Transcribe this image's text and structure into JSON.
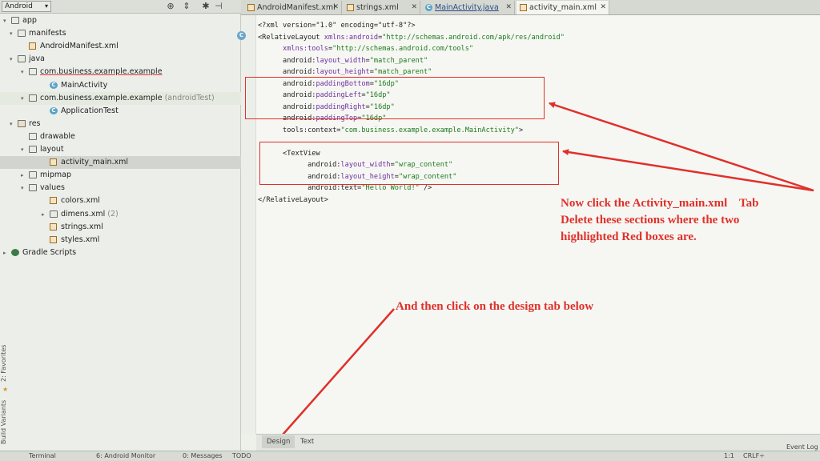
{
  "project_panel": {
    "view_selector": "Android",
    "tree": [
      {
        "label": "app",
        "suffix": "",
        "indent": 0,
        "arrow": "▾",
        "icon": "app-folder-icon"
      },
      {
        "label": "manifests",
        "suffix": "",
        "indent": 1,
        "arrow": "▾",
        "icon": "folder-icon"
      },
      {
        "label": "AndroidManifest.xml",
        "suffix": "",
        "indent": 2,
        "arrow": "",
        "icon": "xml-file-icon"
      },
      {
        "label": "java",
        "suffix": "",
        "indent": 1,
        "arrow": "▾",
        "icon": "folder-icon"
      },
      {
        "label": "com.business.example.example",
        "suffix": "",
        "indent": 2,
        "arrow": "▾",
        "icon": "package-icon"
      },
      {
        "label": "MainActivity",
        "suffix": "",
        "indent": 3,
        "arrow": "",
        "icon": "class-icon"
      },
      {
        "label": "com.business.example.example",
        "suffix": " (androidTest)",
        "indent": 2,
        "arrow": "▾",
        "icon": "package-icon"
      },
      {
        "label": "ApplicationTest",
        "suffix": "",
        "indent": 3,
        "arrow": "",
        "icon": "class-icon"
      },
      {
        "label": "res",
        "suffix": "",
        "indent": 1,
        "arrow": "▾",
        "icon": "res-folder-icon"
      },
      {
        "label": "drawable",
        "suffix": "",
        "indent": 2,
        "arrow": "",
        "icon": "folder-icon"
      },
      {
        "label": "layout",
        "suffix": "",
        "indent": 2,
        "arrow": "▾",
        "icon": "folder-icon"
      },
      {
        "label": "activity_main.xml",
        "suffix": "",
        "indent": 3,
        "arrow": "",
        "icon": "xml-file-icon"
      },
      {
        "label": "mipmap",
        "suffix": "",
        "indent": 2,
        "arrow": "▸",
        "icon": "folder-icon"
      },
      {
        "label": "values",
        "suffix": "",
        "indent": 2,
        "arrow": "▾",
        "icon": "folder-icon"
      },
      {
        "label": "colors.xml",
        "suffix": "",
        "indent": 3,
        "arrow": "",
        "icon": "xml-file-icon"
      },
      {
        "label": "dimens.xml",
        "suffix": " (2)",
        "indent": 3,
        "arrow": "▸",
        "icon": "folder-icon"
      },
      {
        "label": "strings.xml",
        "suffix": "",
        "indent": 3,
        "arrow": "",
        "icon": "xml-file-icon"
      },
      {
        "label": "styles.xml",
        "suffix": "",
        "indent": 3,
        "arrow": "",
        "icon": "xml-file-icon"
      },
      {
        "label": "Gradle Scripts",
        "suffix": "",
        "indent": 0,
        "arrow": "▸",
        "icon": "gradle-icon"
      }
    ],
    "selected_item": "activity_main.xml",
    "side_tabs": [
      "2: Favorites",
      "Build Variants"
    ]
  },
  "editor_tabs": [
    {
      "label": "AndroidManifest.xml",
      "icon": "xml-file-icon",
      "active": false
    },
    {
      "label": "strings.xml",
      "icon": "xml-file-icon",
      "active": false
    },
    {
      "label": "MainActivity.java",
      "icon": "class-icon",
      "active": false
    },
    {
      "label": "activity_main.xml",
      "icon": "xml-file-icon",
      "active": true
    }
  ],
  "code_lines": [
    {
      "indent": 0,
      "parts": [
        [
          "t",
          "<?xml version=\"1.0\" encoding=\"utf-8\"?>"
        ]
      ]
    },
    {
      "indent": 0,
      "parts": [
        [
          "t",
          "<RelativeLayout "
        ],
        [
          "a",
          "xmlns:android"
        ],
        [
          "t",
          "="
        ],
        [
          "v",
          "\"http://schemas.android.com/apk/res/android\""
        ]
      ]
    },
    {
      "indent": 1,
      "parts": [
        [
          "a",
          "xmlns:tools"
        ],
        [
          "t",
          "="
        ],
        [
          "v",
          "\"http://schemas.android.com/tools\""
        ]
      ]
    },
    {
      "indent": 1,
      "parts": [
        [
          "t",
          "android:"
        ],
        [
          "a",
          "layout_width"
        ],
        [
          "t",
          "="
        ],
        [
          "v",
          "\"match_parent\""
        ]
      ]
    },
    {
      "indent": 1,
      "parts": [
        [
          "t",
          "android:"
        ],
        [
          "a",
          "layout_height"
        ],
        [
          "t",
          "="
        ],
        [
          "v",
          "\"match_parent\""
        ]
      ]
    },
    {
      "indent": 1,
      "parts": [
        [
          "t",
          "android:"
        ],
        [
          "a",
          "paddingBottom"
        ],
        [
          "t",
          "="
        ],
        [
          "v",
          "\"16dp\""
        ]
      ]
    },
    {
      "indent": 1,
      "parts": [
        [
          "t",
          "android:"
        ],
        [
          "a",
          "paddingLeft"
        ],
        [
          "t",
          "="
        ],
        [
          "v",
          "\"16dp\""
        ]
      ]
    },
    {
      "indent": 1,
      "parts": [
        [
          "t",
          "android:"
        ],
        [
          "a",
          "paddingRight"
        ],
        [
          "t",
          "="
        ],
        [
          "v",
          "\"16dp\""
        ]
      ]
    },
    {
      "indent": 1,
      "parts": [
        [
          "t",
          "android:"
        ],
        [
          "a",
          "paddingTop"
        ],
        [
          "t",
          "="
        ],
        [
          "v",
          "\"16dp\""
        ]
      ]
    },
    {
      "indent": 1,
      "parts": [
        [
          "t",
          "tools:context="
        ],
        [
          "v",
          "\"com.business.example.example.MainActivity\""
        ],
        [
          "t",
          ">"
        ]
      ]
    },
    {
      "indent": 0,
      "parts": [
        [
          "t",
          ""
        ]
      ]
    },
    {
      "indent": 1,
      "parts": [
        [
          "t",
          "<TextView"
        ]
      ]
    },
    {
      "indent": 2,
      "parts": [
        [
          "t",
          "android:"
        ],
        [
          "a",
          "layout_width"
        ],
        [
          "t",
          "="
        ],
        [
          "v",
          "\"wrap_content\""
        ]
      ]
    },
    {
      "indent": 2,
      "parts": [
        [
          "t",
          "android:"
        ],
        [
          "a",
          "layout_height"
        ],
        [
          "t",
          "="
        ],
        [
          "v",
          "\"wrap_content\""
        ]
      ]
    },
    {
      "indent": 2,
      "parts": [
        [
          "t",
          "android:text="
        ],
        [
          "v",
          "\"Hello World!\""
        ],
        [
          "t",
          " />"
        ]
      ]
    },
    {
      "indent": 0,
      "parts": [
        [
          "t",
          "</RelativeLayout>"
        ]
      ]
    }
  ],
  "annotations": {
    "activity_instruction": "Now click the Activity_main.xml    Tab\nDelete these sections where the two\nhighlighted Red boxes are.",
    "design_instruction": "And then click on the design tab below"
  },
  "design_text_tabs": [
    {
      "label": "Design",
      "selected": true
    },
    {
      "label": "Text",
      "selected": false
    }
  ],
  "status_bar": {
    "terminal": "Terminal",
    "android_monitor": "6: Android Monitor",
    "messages": "0: Messages",
    "todo": "TODO",
    "event_log": "Event Log",
    "caret": "1:1",
    "line_sep": "CRLF÷"
  },
  "colors": {
    "annotation_red": "#e0302a",
    "xml_attribute": "#6f2fa0",
    "xml_value": "#1d7a1d"
  }
}
